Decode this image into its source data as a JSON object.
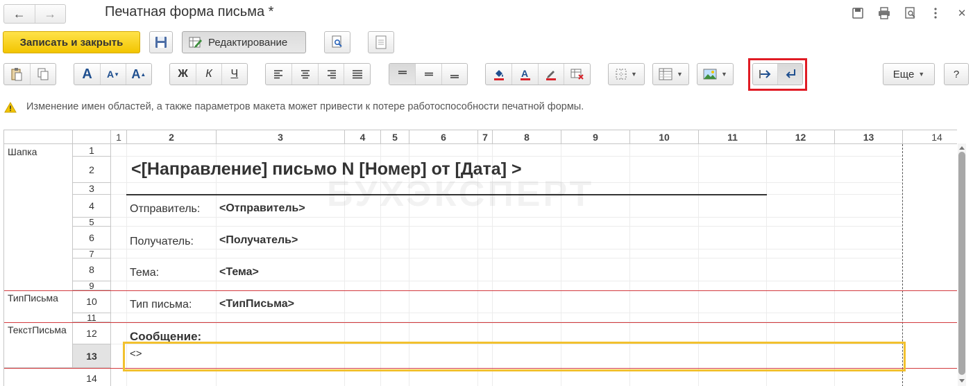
{
  "window": {
    "title": "Печатная форма письма *",
    "nav_back_icon": "arrow-left-icon",
    "nav_forward_icon": "arrow-right-icon"
  },
  "commandbar": {
    "save_close_label": "Записать и закрыть",
    "edit_label": "Редактирование",
    "more_label": "Еще",
    "help_label": "?"
  },
  "format": {
    "bold": "Ж",
    "italic": "К",
    "underline": "Ч",
    "font_big": "A",
    "font_inc": "A",
    "font_dec": "A"
  },
  "warning": {
    "text": "Изменение имен областей, а также параметров макета может привести к потере работоспособности печатной формы."
  },
  "grid": {
    "columns": [
      "1",
      "2",
      "3",
      "4",
      "5",
      "6",
      "7",
      "8",
      "9",
      "10",
      "11",
      "12",
      "13",
      "14"
    ],
    "rows": [
      "1",
      "2",
      "3",
      "4",
      "5",
      "6",
      "7",
      "8",
      "9",
      "10",
      "11",
      "12",
      "13",
      "14"
    ],
    "selected_row": "13",
    "areas": [
      "Шапка",
      "ТипПисьма",
      "ТекстПисьма"
    ]
  },
  "cells": {
    "heading": "<[Направление] письмо N [Номер] от [Дата] >",
    "sender_label": "Отправитель:",
    "sender_param": "<Отправитель>",
    "recipient_label": "Получатель:",
    "recipient_param": "<Получатель>",
    "subject_label": "Тема:",
    "subject_param": "<Тема>",
    "type_label": "Тип письма:",
    "type_param": "<ТипПисьма>",
    "message_label": "Сообщение:",
    "message_param": "<>"
  },
  "watermark": "БУХЭКСПЕРТ",
  "colors": {
    "accent_yellow": "#f2c500",
    "highlight_red": "#e01b24",
    "selection_yellow": "#f2c12e",
    "area_line": "#d2393d"
  }
}
